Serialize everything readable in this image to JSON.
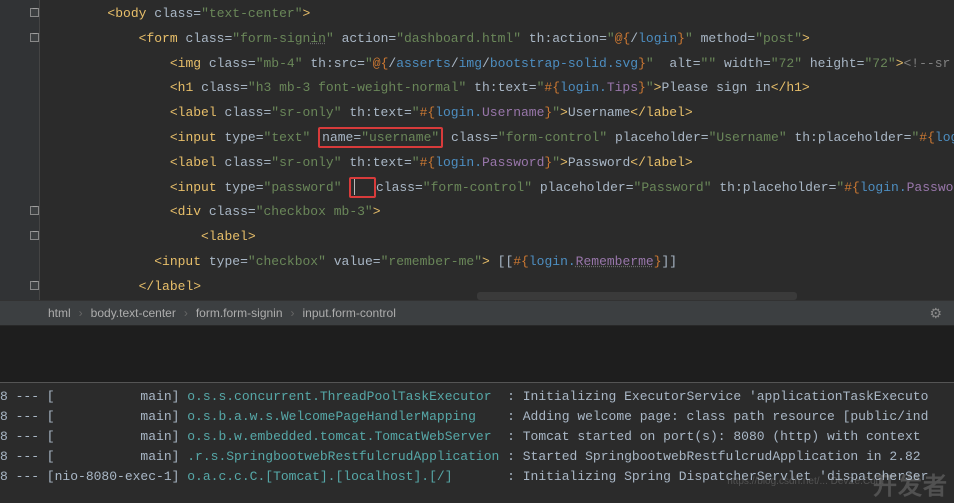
{
  "code_lines": [
    {
      "indent": 4,
      "segs": [
        {
          "t": "angle",
          "v": "<"
        },
        {
          "t": "tag",
          "v": "body"
        },
        {
          "t": "text-node",
          "v": " "
        },
        {
          "t": "attr-name",
          "v": "class"
        },
        {
          "t": "eq",
          "v": "="
        },
        {
          "t": "quote",
          "v": "\""
        },
        {
          "t": "attr-val",
          "v": "text-center"
        },
        {
          "t": "quote",
          "v": "\""
        },
        {
          "t": "angle",
          "v": ">"
        }
      ]
    },
    {
      "indent": 6,
      "segs": [
        {
          "t": "angle",
          "v": "<"
        },
        {
          "t": "tag",
          "v": "form"
        },
        {
          "t": "text-node",
          "v": " "
        },
        {
          "t": "attr-name",
          "v": "class"
        },
        {
          "t": "eq",
          "v": "="
        },
        {
          "t": "quote",
          "v": "\""
        },
        {
          "t": "attr-val",
          "v": "form-sign"
        },
        {
          "t": "attr-val underline",
          "v": "in"
        },
        {
          "t": "quote",
          "v": "\""
        },
        {
          "t": "text-node",
          "v": " "
        },
        {
          "t": "attr-name",
          "v": "action"
        },
        {
          "t": "eq",
          "v": "="
        },
        {
          "t": "quote",
          "v": "\""
        },
        {
          "t": "attr-val",
          "v": "dashboard.html"
        },
        {
          "t": "quote",
          "v": "\""
        },
        {
          "t": "text-node",
          "v": " "
        },
        {
          "t": "attr-name",
          "v": "th:action"
        },
        {
          "t": "eq",
          "v": "="
        },
        {
          "t": "quote",
          "v": "\""
        },
        {
          "t": "th-token",
          "v": "@{"
        },
        {
          "t": "th-slash",
          "v": "/"
        },
        {
          "t": "th-expr",
          "v": "login"
        },
        {
          "t": "th-token",
          "v": "}"
        },
        {
          "t": "quote",
          "v": "\""
        },
        {
          "t": "text-node",
          "v": " "
        },
        {
          "t": "attr-name",
          "v": "method"
        },
        {
          "t": "eq",
          "v": "="
        },
        {
          "t": "quote",
          "v": "\""
        },
        {
          "t": "attr-val",
          "v": "post"
        },
        {
          "t": "quote",
          "v": "\""
        },
        {
          "t": "angle",
          "v": ">"
        }
      ]
    },
    {
      "indent": 8,
      "segs": [
        {
          "t": "angle",
          "v": "<"
        },
        {
          "t": "tag",
          "v": "img"
        },
        {
          "t": "text-node",
          "v": " "
        },
        {
          "t": "attr-name",
          "v": "class"
        },
        {
          "t": "eq",
          "v": "="
        },
        {
          "t": "quote",
          "v": "\""
        },
        {
          "t": "attr-val",
          "v": "mb-4"
        },
        {
          "t": "quote",
          "v": "\""
        },
        {
          "t": "text-node",
          "v": " "
        },
        {
          "t": "attr-name",
          "v": "th:src"
        },
        {
          "t": "eq",
          "v": "="
        },
        {
          "t": "quote",
          "v": "\""
        },
        {
          "t": "th-token",
          "v": "@{"
        },
        {
          "t": "th-slash",
          "v": "/"
        },
        {
          "t": "th-expr",
          "v": "asserts"
        },
        {
          "t": "th-slash",
          "v": "/"
        },
        {
          "t": "th-expr",
          "v": "img"
        },
        {
          "t": "th-slash",
          "v": "/"
        },
        {
          "t": "th-expr",
          "v": "bootstrap-solid."
        },
        {
          "t": "th-expr",
          "v": "svg"
        },
        {
          "t": "th-token",
          "v": "}"
        },
        {
          "t": "quote",
          "v": "\""
        },
        {
          "t": "text-node",
          "v": "  "
        },
        {
          "t": "attr-name",
          "v": "alt"
        },
        {
          "t": "eq",
          "v": "="
        },
        {
          "t": "quote",
          "v": "\"\""
        },
        {
          "t": "text-node",
          "v": " "
        },
        {
          "t": "attr-name",
          "v": "width"
        },
        {
          "t": "eq",
          "v": "="
        },
        {
          "t": "quote",
          "v": "\""
        },
        {
          "t": "attr-val",
          "v": "72"
        },
        {
          "t": "quote",
          "v": "\""
        },
        {
          "t": "text-node",
          "v": " "
        },
        {
          "t": "attr-name",
          "v": "height"
        },
        {
          "t": "eq",
          "v": "="
        },
        {
          "t": "quote",
          "v": "\""
        },
        {
          "t": "attr-val",
          "v": "72"
        },
        {
          "t": "quote",
          "v": "\""
        },
        {
          "t": "angle",
          "v": ">"
        },
        {
          "t": "comment",
          "v": "<!--sr"
        }
      ]
    },
    {
      "indent": 8,
      "segs": [
        {
          "t": "angle",
          "v": "<"
        },
        {
          "t": "tag",
          "v": "h1"
        },
        {
          "t": "text-node",
          "v": " "
        },
        {
          "t": "attr-name",
          "v": "class"
        },
        {
          "t": "eq",
          "v": "="
        },
        {
          "t": "quote",
          "v": "\""
        },
        {
          "t": "attr-val",
          "v": "h3 mb-3 font-weight-normal"
        },
        {
          "t": "quote",
          "v": "\""
        },
        {
          "t": "text-node",
          "v": " "
        },
        {
          "t": "attr-name",
          "v": "th:text"
        },
        {
          "t": "eq",
          "v": "="
        },
        {
          "t": "quote",
          "v": "\""
        },
        {
          "t": "th-token",
          "v": "#{"
        },
        {
          "t": "th-expr",
          "v": "login."
        },
        {
          "t": "th-prop",
          "v": "Tips"
        },
        {
          "t": "th-token",
          "v": "}"
        },
        {
          "t": "quote",
          "v": "\""
        },
        {
          "t": "angle",
          "v": ">"
        },
        {
          "t": "text-node",
          "v": "Please sign in"
        },
        {
          "t": "angle",
          "v": "</"
        },
        {
          "t": "tag",
          "v": "h1"
        },
        {
          "t": "angle",
          "v": ">"
        }
      ]
    },
    {
      "indent": 8,
      "segs": [
        {
          "t": "angle",
          "v": "<"
        },
        {
          "t": "tag",
          "v": "label"
        },
        {
          "t": "text-node",
          "v": " "
        },
        {
          "t": "attr-name",
          "v": "class"
        },
        {
          "t": "eq",
          "v": "="
        },
        {
          "t": "quote",
          "v": "\""
        },
        {
          "t": "attr-val",
          "v": "sr-only"
        },
        {
          "t": "quote",
          "v": "\""
        },
        {
          "t": "text-node",
          "v": " "
        },
        {
          "t": "attr-name",
          "v": "th:text"
        },
        {
          "t": "eq",
          "v": "="
        },
        {
          "t": "quote",
          "v": "\""
        },
        {
          "t": "th-token",
          "v": "#{"
        },
        {
          "t": "th-expr",
          "v": "login."
        },
        {
          "t": "th-prop",
          "v": "Username"
        },
        {
          "t": "th-token",
          "v": "}"
        },
        {
          "t": "quote",
          "v": "\""
        },
        {
          "t": "angle",
          "v": ">"
        },
        {
          "t": "text-node",
          "v": "Username"
        },
        {
          "t": "angle",
          "v": "</"
        },
        {
          "t": "tag",
          "v": "label"
        },
        {
          "t": "angle",
          "v": ">"
        }
      ]
    },
    {
      "indent": 8,
      "segs": [
        {
          "t": "angle",
          "v": "<"
        },
        {
          "t": "tag",
          "v": "input"
        },
        {
          "t": "text-node",
          "v": " "
        },
        {
          "t": "attr-name",
          "v": "type"
        },
        {
          "t": "eq",
          "v": "="
        },
        {
          "t": "quote",
          "v": "\""
        },
        {
          "t": "attr-val",
          "v": "text"
        },
        {
          "t": "quote",
          "v": "\""
        },
        {
          "t": "text-node",
          "v": " "
        },
        {
          "t": "redbox-open",
          "v": ""
        },
        {
          "t": "attr-name",
          "v": "name"
        },
        {
          "t": "eq",
          "v": "="
        },
        {
          "t": "quote",
          "v": "\""
        },
        {
          "t": "attr-val",
          "v": "username"
        },
        {
          "t": "quote",
          "v": "\""
        },
        {
          "t": "redbox-close",
          "v": ""
        },
        {
          "t": "text-node",
          "v": " "
        },
        {
          "t": "attr-name",
          "v": "class"
        },
        {
          "t": "eq",
          "v": "="
        },
        {
          "t": "quote",
          "v": "\""
        },
        {
          "t": "attr-val",
          "v": "form-control"
        },
        {
          "t": "quote",
          "v": "\""
        },
        {
          "t": "text-node",
          "v": " "
        },
        {
          "t": "attr-name",
          "v": "placeholder"
        },
        {
          "t": "eq",
          "v": "="
        },
        {
          "t": "quote",
          "v": "\""
        },
        {
          "t": "attr-val",
          "v": "Username"
        },
        {
          "t": "quote",
          "v": "\""
        },
        {
          "t": "text-node",
          "v": " "
        },
        {
          "t": "attr-name",
          "v": "th:placeholder"
        },
        {
          "t": "eq",
          "v": "="
        },
        {
          "t": "quote",
          "v": "\""
        },
        {
          "t": "th-token",
          "v": "#{"
        },
        {
          "t": "th-expr",
          "v": "logi"
        }
      ]
    },
    {
      "indent": 8,
      "segs": [
        {
          "t": "angle",
          "v": "<"
        },
        {
          "t": "tag",
          "v": "label"
        },
        {
          "t": "text-node",
          "v": " "
        },
        {
          "t": "attr-name",
          "v": "class"
        },
        {
          "t": "eq",
          "v": "="
        },
        {
          "t": "quote",
          "v": "\""
        },
        {
          "t": "attr-val",
          "v": "sr-only"
        },
        {
          "t": "quote",
          "v": "\""
        },
        {
          "t": "text-node",
          "v": " "
        },
        {
          "t": "attr-name",
          "v": "th:text"
        },
        {
          "t": "eq",
          "v": "="
        },
        {
          "t": "quote",
          "v": "\""
        },
        {
          "t": "th-token",
          "v": "#{"
        },
        {
          "t": "th-expr",
          "v": "login."
        },
        {
          "t": "th-prop",
          "v": "Password"
        },
        {
          "t": "th-token",
          "v": "}"
        },
        {
          "t": "quote",
          "v": "\""
        },
        {
          "t": "angle",
          "v": ">"
        },
        {
          "t": "text-node",
          "v": "Password"
        },
        {
          "t": "angle",
          "v": "</"
        },
        {
          "t": "tag",
          "v": "label"
        },
        {
          "t": "angle",
          "v": ">"
        }
      ]
    },
    {
      "indent": 8,
      "segs": [
        {
          "t": "angle",
          "v": "<"
        },
        {
          "t": "tag",
          "v": "input"
        },
        {
          "t": "text-node",
          "v": " "
        },
        {
          "t": "attr-name",
          "v": "type"
        },
        {
          "t": "eq",
          "v": "="
        },
        {
          "t": "quote",
          "v": "\""
        },
        {
          "t": "attr-val",
          "v": "password"
        },
        {
          "t": "quote",
          "v": "\""
        },
        {
          "t": "text-node",
          "v": " "
        },
        {
          "t": "redbox-open",
          "v": ""
        },
        {
          "t": "cursor",
          "v": ""
        },
        {
          "t": "redbox-close",
          "v": ""
        },
        {
          "t": "attr-name",
          "v": "class"
        },
        {
          "t": "eq",
          "v": "="
        },
        {
          "t": "quote",
          "v": "\""
        },
        {
          "t": "attr-val",
          "v": "form-control"
        },
        {
          "t": "quote",
          "v": "\""
        },
        {
          "t": "text-node",
          "v": " "
        },
        {
          "t": "attr-name",
          "v": "placeholder"
        },
        {
          "t": "eq",
          "v": "="
        },
        {
          "t": "quote",
          "v": "\""
        },
        {
          "t": "attr-val",
          "v": "Password"
        },
        {
          "t": "quote",
          "v": "\""
        },
        {
          "t": "text-node",
          "v": " "
        },
        {
          "t": "attr-name",
          "v": "th:placeholder"
        },
        {
          "t": "eq",
          "v": "="
        },
        {
          "t": "quote",
          "v": "\""
        },
        {
          "t": "th-token",
          "v": "#{"
        },
        {
          "t": "th-expr",
          "v": "login."
        },
        {
          "t": "th-prop",
          "v": "Password"
        },
        {
          "t": "th-token",
          "v": "}"
        }
      ]
    },
    {
      "indent": 8,
      "segs": [
        {
          "t": "angle",
          "v": "<"
        },
        {
          "t": "tag",
          "v": "div"
        },
        {
          "t": "text-node",
          "v": " "
        },
        {
          "t": "attr-name",
          "v": "class"
        },
        {
          "t": "eq",
          "v": "="
        },
        {
          "t": "quote",
          "v": "\""
        },
        {
          "t": "attr-val",
          "v": "checkbox mb-3"
        },
        {
          "t": "quote",
          "v": "\""
        },
        {
          "t": "angle",
          "v": ">"
        }
      ]
    },
    {
      "indent": 10,
      "segs": [
        {
          "t": "angle",
          "v": "<"
        },
        {
          "t": "tag",
          "v": "label"
        },
        {
          "t": "angle",
          "v": ">"
        }
      ]
    },
    {
      "indent": 7,
      "segs": [
        {
          "t": "angle",
          "v": "<"
        },
        {
          "t": "tag",
          "v": "input"
        },
        {
          "t": "text-node",
          "v": " "
        },
        {
          "t": "attr-name",
          "v": "type"
        },
        {
          "t": "eq",
          "v": "="
        },
        {
          "t": "quote",
          "v": "\""
        },
        {
          "t": "attr-val",
          "v": "checkbox"
        },
        {
          "t": "quote",
          "v": "\""
        },
        {
          "t": "text-node",
          "v": " "
        },
        {
          "t": "attr-name",
          "v": "value"
        },
        {
          "t": "eq",
          "v": "="
        },
        {
          "t": "quote",
          "v": "\""
        },
        {
          "t": "attr-val",
          "v": "remember-me"
        },
        {
          "t": "quote",
          "v": "\""
        },
        {
          "t": "angle",
          "v": ">"
        },
        {
          "t": "text-node",
          "v": " [["
        },
        {
          "t": "th-token",
          "v": "#{"
        },
        {
          "t": "th-expr",
          "v": "login."
        },
        {
          "t": "th-prop underline",
          "v": "Rememberme"
        },
        {
          "t": "th-token",
          "v": "}"
        },
        {
          "t": "text-node",
          "v": "]]"
        }
      ]
    },
    {
      "indent": 6,
      "segs": [
        {
          "t": "angle",
          "v": "</"
        },
        {
          "t": "tag",
          "v": "label"
        },
        {
          "t": "angle",
          "v": ">"
        }
      ]
    }
  ],
  "fold_rows": [
    0,
    1,
    8,
    9,
    11
  ],
  "breadcrumb": [
    "html",
    "body.text-center",
    "form.form-signin",
    "input.form-control"
  ],
  "console": [
    {
      "prefix": "8 --- [",
      "thread": "           main",
      "b": "] ",
      "logger": "o.s.s.concurrent.ThreadPoolTaskExecutor ",
      "msg": " : Initializing ExecutorService 'applicationTaskExecuto"
    },
    {
      "prefix": "8 --- [",
      "thread": "           main",
      "b": "] ",
      "logger": "o.s.b.a.w.s.WelcomePageHandlerMapping   ",
      "msg": " : Adding welcome page: class path resource [public/ind"
    },
    {
      "prefix": "8 --- [",
      "thread": "           main",
      "b": "] ",
      "logger": "o.s.b.w.embedded.tomcat.TomcatWebServer ",
      "msg": " : Tomcat started on port(s): 8080 (http) with context"
    },
    {
      "prefix": "8 --- [",
      "thread": "           main",
      "b": "] ",
      "logger": ".r.s.SpringbootwebRestfulcrudApplication",
      "msg": " : Started SpringbootwebRestfulcrudApplication in 2.82"
    },
    {
      "prefix": "8 --- [",
      "thread": "nio-8080-exec-1",
      "b": "] ",
      "logger": "o.a.c.c.C.[Tomcat].[localhost].[/]      ",
      "msg": " : Initializing Spring DispatcherServlet 'dispatcherSer"
    }
  ],
  "watermark": "开发者",
  "watermark_url": "https://blog.csdn.net/... DevZe.Com"
}
